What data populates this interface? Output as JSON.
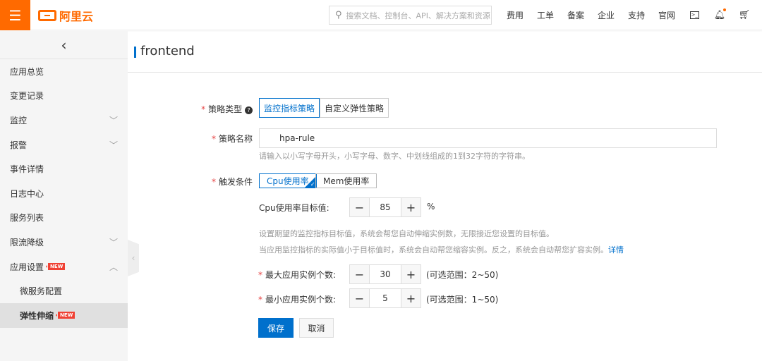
{
  "topbar": {
    "logo_text": "阿里云",
    "search_placeholder": "搜索文档、控制台、API、解决方案和资源",
    "nav": [
      "费用",
      "工单",
      "备案",
      "企业",
      "支持",
      "官网"
    ]
  },
  "sidebar": {
    "items": [
      {
        "label": "应用总览"
      },
      {
        "label": "变更记录"
      },
      {
        "label": "监控"
      },
      {
        "label": "报警"
      },
      {
        "label": "事件详情"
      },
      {
        "label": "日志中心"
      },
      {
        "label": "服务列表"
      },
      {
        "label": "限流降级"
      },
      {
        "label": "应用设置",
        "badge": "NEW"
      },
      {
        "label": "微服务配置"
      },
      {
        "label": "弹性伸缩",
        "badge": "NEW"
      }
    ]
  },
  "header": {
    "title": "frontend"
  },
  "form": {
    "policy_type_label": "策略类型",
    "policy_types": [
      "监控指标策略",
      "自定义弹性策略"
    ],
    "policy_name_label": "策略名称",
    "policy_name_value": "hpa-rule",
    "policy_name_hint": "请输入以小写字母开头，小写字母、数字、中划线组成的1到32字符的字符串。",
    "trigger_label": "触发条件",
    "triggers": [
      "Cpu使用率",
      "Mem使用率"
    ],
    "cpu_target_label": "Cpu使用率目标值:",
    "cpu_target_value": "85",
    "cpu_unit": "%",
    "hint1": "设置期望的监控指标目标值，系统会帮您自动伸缩实例数，无限接近您设置的目标值。",
    "hint2": "当应用监控指标的实际值小于目标值时，系统会自动帮您缩容实例。反之，系统会自动帮您扩容实例。",
    "details_link": "详情",
    "max_label": "最大应用实例个数:",
    "max_value": "30",
    "max_range": "(可选范围：2~50)",
    "min_label": "最小应用实例个数:",
    "min_value": "5",
    "min_range": "(可选范围：1~50)",
    "save": "保存",
    "cancel": "取消"
  }
}
